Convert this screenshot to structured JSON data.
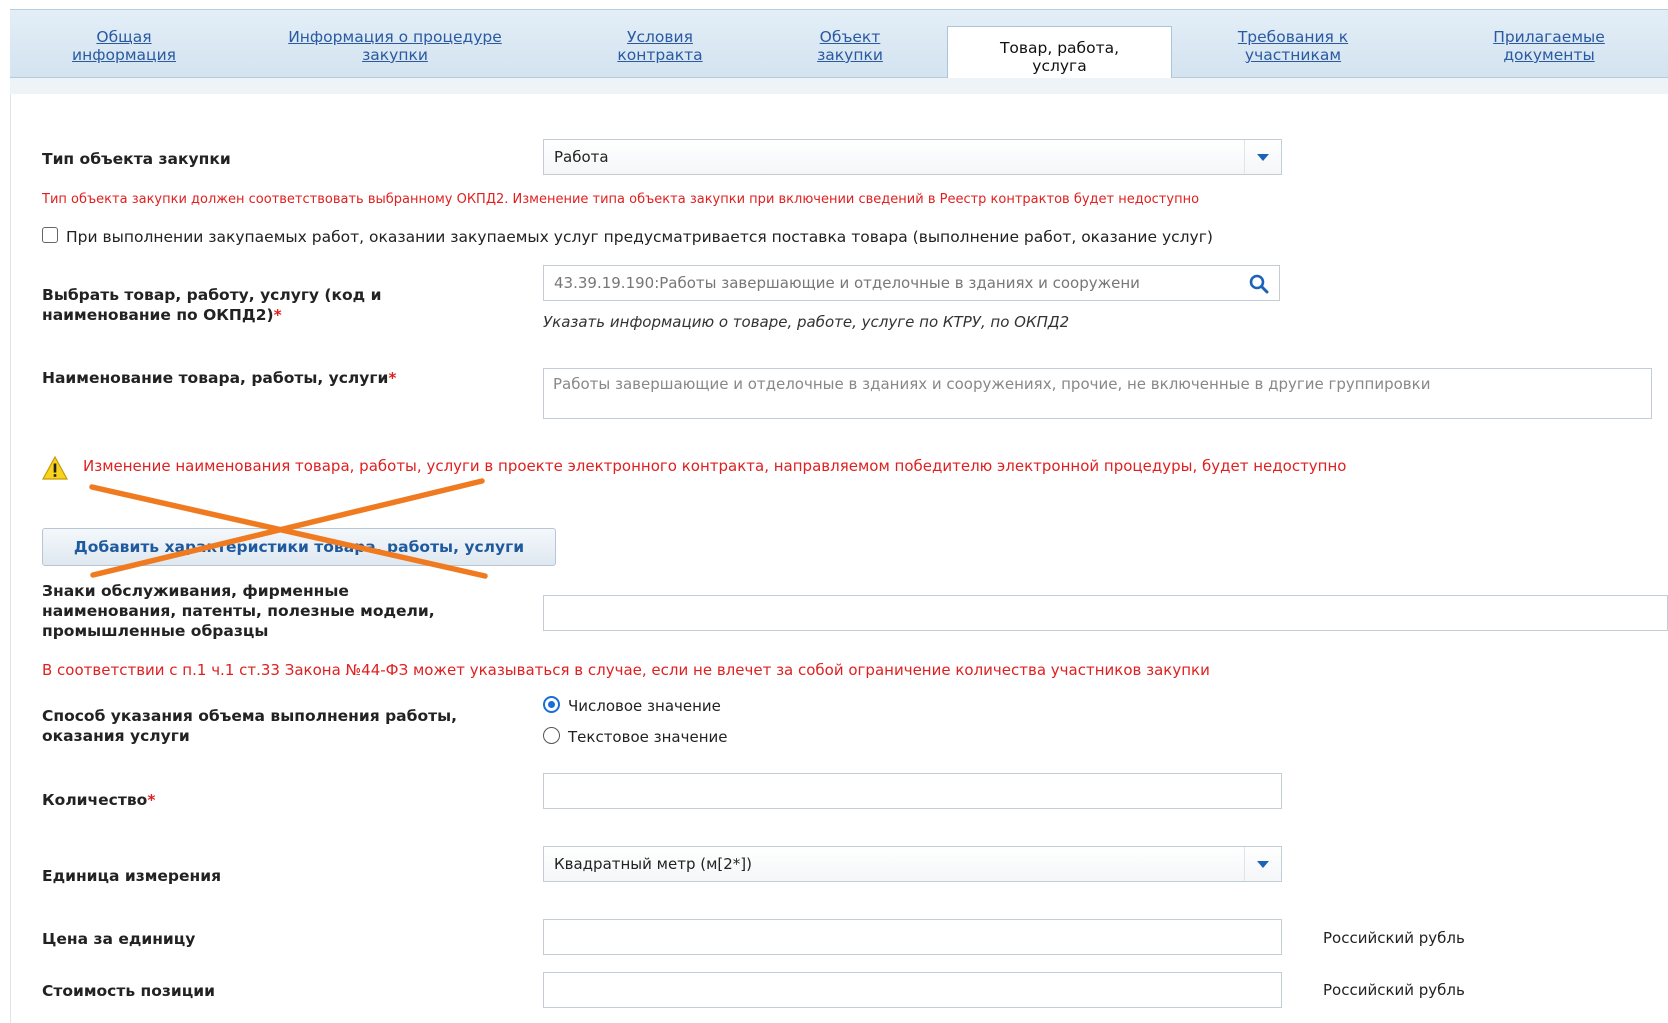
{
  "tabs": [
    {
      "label_1": "Общая",
      "label_2": "информация"
    },
    {
      "label_1": "Информация о процедуре",
      "label_2": "закупки"
    },
    {
      "label_1": "Условия",
      "label_2": "контракта"
    },
    {
      "label_1": "Объект",
      "label_2": "закупки"
    },
    {
      "label_1": "Товар, работа,",
      "label_2": "услуга"
    },
    {
      "label_1": "Требования к",
      "label_2": "участникам"
    },
    {
      "label_1": "Прилагаемые",
      "label_2": "документы"
    }
  ],
  "form": {
    "object_type": {
      "label": "Тип объекта закупки",
      "value": "Работа",
      "warning": "Тип объекта закупки должен соответствовать выбранному ОКПД2. Изменение типа объекта закупки при включении сведений в Реестр контрактов будет недоступно"
    },
    "goods_supply_checkbox": {
      "checked": false,
      "label": "При выполнении закупаемых работ, оказании закупаемых услуг предусматривается поставка товара (выполнение работ, оказание услуг)"
    },
    "okpd": {
      "label_1": "Выбрать товар, работу, услугу (код и",
      "label_2": "наименование по ОКПД2)",
      "required_mark": "*",
      "value": "43.39.19.190:Работы завершающие и отделочные в зданиях и сооружени",
      "hint": "Указать информацию о товаре, работе, услуге по КТРУ, по ОКПД2"
    },
    "item_name": {
      "label": "Наименование товара, работы, услуги",
      "required_mark": "*",
      "value": "Работы завершающие и отделочные в зданиях и сооружениях, прочие, не включенные в другие группировки"
    },
    "name_warning": "Изменение наименования товара, работы, услуги в проекте электронного контракта, направляемом победителю электронной процедуры, будет недоступно",
    "add_characteristics_button": "Добавить характеристики товара, работы, услуги",
    "trademarks": {
      "label_1": "Знаки обслуживания, фирменные",
      "label_2": "наименования, патенты, полезные модели,",
      "label_3": "промышленные образцы",
      "value": "",
      "note": "В соответствии с п.1 ч.1 ст.33 Закона №44-ФЗ может указываться в случае, если не влечет за собой ограничение количества участников закупки"
    },
    "volume_method": {
      "label_1": "Способ указания объема выполнения работы,",
      "label_2": "оказания услуги",
      "options": [
        "Числовое значение",
        "Текстовое значение"
      ],
      "selected": "Числовое значение"
    },
    "quantity": {
      "label": "Количество",
      "required_mark": "*",
      "value": ""
    },
    "unit": {
      "label": "Единица измерения",
      "value": "Квадратный метр (м[2*])"
    },
    "unit_price": {
      "label": "Цена за единицу",
      "value": "",
      "currency": "Российский рубль"
    },
    "position_cost": {
      "label": "Стоимость позиции",
      "value": "",
      "currency": "Российский рубль"
    }
  },
  "colors": {
    "link": "#2a5aa0",
    "error": "#e02020",
    "annotation": "#f07a20",
    "accent": "#1a6fd6"
  }
}
